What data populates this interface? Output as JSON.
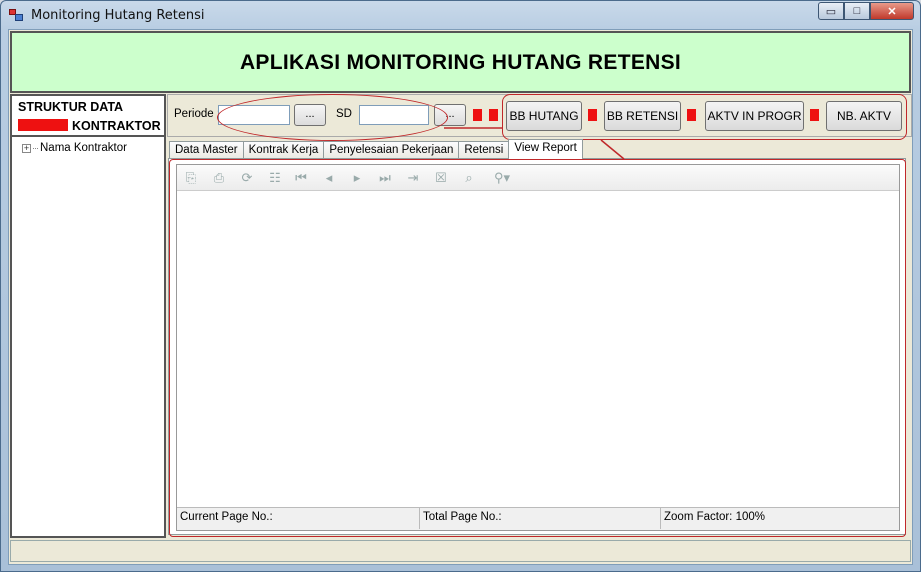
{
  "window": {
    "title": "Monitoring Hutang Retensi",
    "controls": {
      "minimize": "▭",
      "maximize": "□",
      "close": "✕"
    }
  },
  "banner": {
    "title": "APLIKASI MONITORING HUTANG RETENSI"
  },
  "left_panel": {
    "header": "STRUKTUR DATA",
    "subheader": "KONTRAKTOR",
    "tree": [
      {
        "label": "Nama Kontraktor",
        "expander": "+"
      }
    ]
  },
  "toolbar": {
    "periode_label": "Periode :",
    "periode_value": "",
    "periode_button": "...",
    "sd_label": "SD",
    "sd_value": "",
    "sd_button": "...",
    "buttons": [
      "BB HUTANG",
      "BB RETENSI",
      "AKTV IN PROGR",
      "NB. AKTV"
    ]
  },
  "tabs": [
    {
      "label": "Data Master",
      "active": false
    },
    {
      "label": "Kontrak Kerja",
      "active": false
    },
    {
      "label": "Penyelesaian Pekerjaan",
      "active": false
    },
    {
      "label": "Retensi",
      "active": false
    },
    {
      "label": "View Report",
      "active": true
    }
  ],
  "report_viewer": {
    "status": {
      "current_page": "Current Page No.:",
      "total_page": "Total Page No.:",
      "zoom": "Zoom Factor: 100%"
    }
  },
  "colors": {
    "banner_bg": "#ccffcc",
    "marker_red": "#ee1111",
    "annotation_red": "#c0282a"
  }
}
